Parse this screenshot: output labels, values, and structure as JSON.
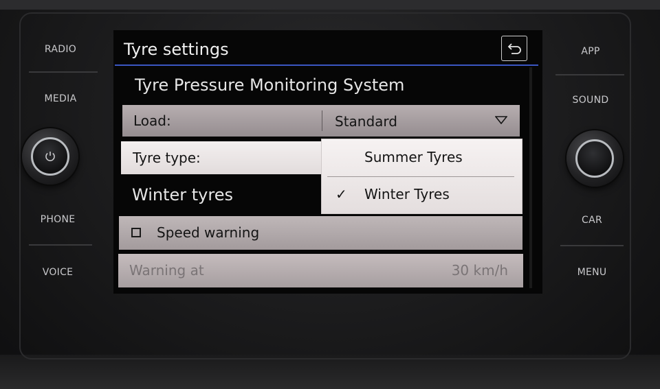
{
  "hardware": {
    "left_buttons": [
      "RADIO",
      "MEDIA",
      "PHONE",
      "VOICE"
    ],
    "right_buttons": [
      "APP",
      "SOUND",
      "CAR",
      "MENU"
    ]
  },
  "screen": {
    "title": "Tyre settings",
    "section_title": "Tyre Pressure Monitoring System",
    "load": {
      "label": "Load:",
      "value": "Standard"
    },
    "tyre_type": {
      "label": "Tyre type:"
    },
    "dropdown": {
      "options": [
        {
          "label": "Summer Tyres",
          "check": ""
        },
        {
          "label": "Winter Tyres",
          "check": "✓"
        }
      ],
      "selected": "Winter Tyres"
    },
    "winter_label": "Winter tyres",
    "speed_warning": {
      "label": "Speed warning",
      "checked": false
    },
    "warning_at": {
      "label": "Warning at",
      "value": "30 km/h"
    }
  },
  "icons": [
    "back-icon",
    "chevron-down-icon",
    "power-icon",
    "checkbox-icon",
    "checkmark-icon"
  ],
  "colors": {
    "accent_line": "#3b57c4",
    "highlight_row": "#f3efef",
    "row": "#a39b9d"
  }
}
